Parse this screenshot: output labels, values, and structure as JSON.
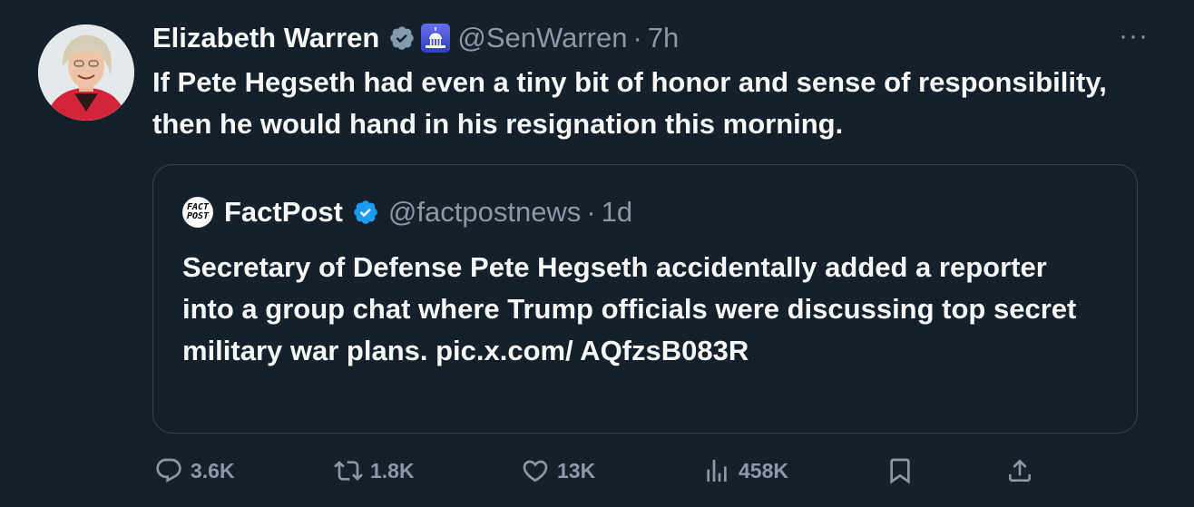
{
  "tweet": {
    "author_name": "Elizabeth Warren",
    "handle": "@SenWarren",
    "separator": "·",
    "time": "7h",
    "more_label": "···",
    "text": "If Pete Hegseth had even a tiny bit of honor and sense of responsibility, then he would hand in his resignation this morning."
  },
  "quote": {
    "logo_line1": "FACT",
    "logo_line2": "POST",
    "author_name": "FactPost",
    "handle": "@factpostnews",
    "separator": "·",
    "time": "1d",
    "text": "Secretary of Defense Pete Hegseth accidentally added a reporter into a group chat where Trump officials were discussing top secret military war plans. pic.x.com/ AQfzsB083R"
  },
  "actions": {
    "replies": "3.6K",
    "reposts": "1.8K",
    "likes": "13K",
    "views": "458K"
  },
  "colors": {
    "background": "#15202b",
    "muted": "#8b98a5",
    "gov_badge": "#829aab",
    "blue_badge": "#1d9bf0"
  }
}
